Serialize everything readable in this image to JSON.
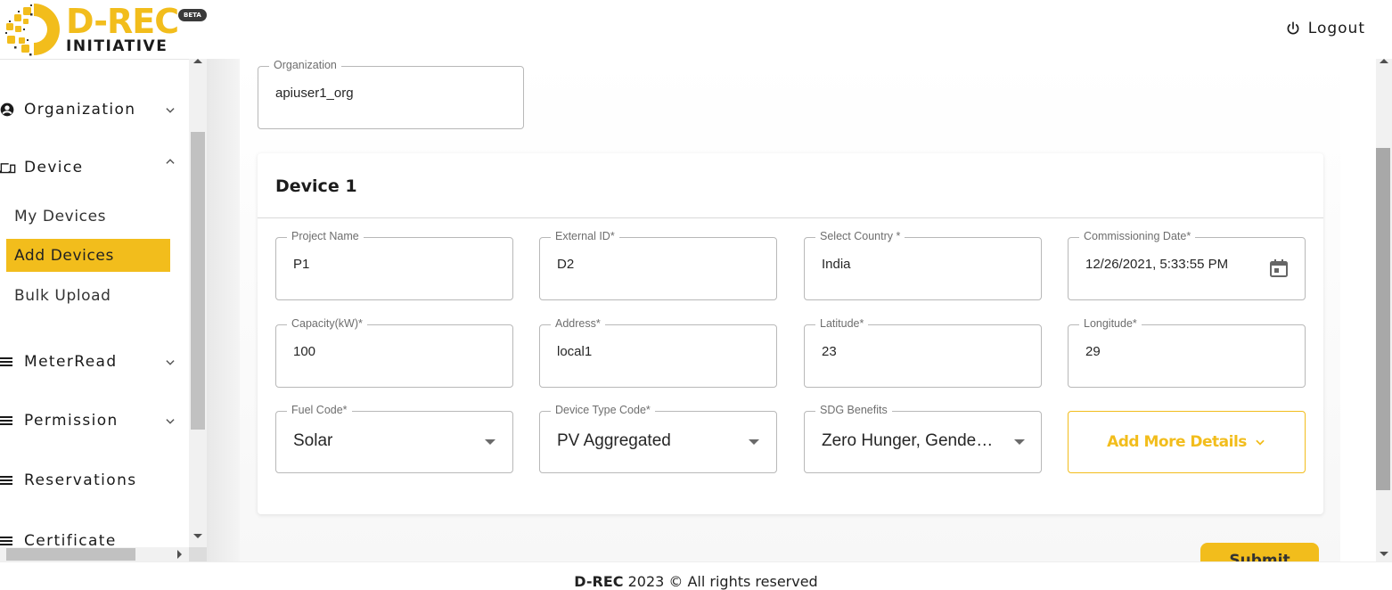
{
  "header": {
    "brand_title": "D-REC",
    "brand_subtitle": "INITIATIVE",
    "beta_badge": "BETA",
    "logout_label": "Logout"
  },
  "sidebar": {
    "items": [
      {
        "label": "Organization",
        "icon": "account-circle-icon",
        "expanded": false
      },
      {
        "label": "Device",
        "icon": "devices-icon",
        "expanded": true,
        "children": [
          {
            "label": "My Devices",
            "active": false
          },
          {
            "label": "Add Devices",
            "active": true
          },
          {
            "label": "Bulk Upload",
            "active": false
          }
        ]
      },
      {
        "label": "MeterRead",
        "icon": "menu-icon",
        "expanded": false
      },
      {
        "label": "Permission",
        "icon": "menu-icon",
        "expanded": false
      },
      {
        "label": "Reservations",
        "icon": "menu-icon"
      },
      {
        "label": "Certificate",
        "icon": "menu-icon"
      }
    ]
  },
  "form": {
    "organization": {
      "label": "Organization",
      "value": "apiuser1_org"
    },
    "device_card": {
      "title": "Device 1",
      "fields": {
        "project_name": {
          "label": "Project Name",
          "value": "P1"
        },
        "external_id": {
          "label": "External ID*",
          "value": "D2"
        },
        "country": {
          "label": "Select Country *",
          "value": "India"
        },
        "commissioning_date": {
          "label": "Commissioning Date*",
          "value": "12/26/2021, 5:33:55 PM"
        },
        "capacity": {
          "label": "Capacity(kW)*",
          "value": "100"
        },
        "address": {
          "label": "Address*",
          "value": "local1"
        },
        "latitude": {
          "label": "Latitude*",
          "value": "23"
        },
        "longitude": {
          "label": "Longitude*",
          "value": "29"
        },
        "fuel_code": {
          "label": "Fuel Code*",
          "value": "Solar"
        },
        "device_type_code": {
          "label": "Device Type Code*",
          "value": "PV Aggregated"
        },
        "sdg_benefits": {
          "label": "SDG Benefits",
          "value": "Zero Hunger, Gende…"
        }
      },
      "add_more_label": "Add More Details"
    },
    "submit_label": "Submit"
  },
  "footer": {
    "brand": "D-REC",
    "text": " 2023 © All rights reserved"
  },
  "colors": {
    "accent": "#f2bd1c",
    "text": "#1a1a1a",
    "border": "#b8b8b8"
  }
}
